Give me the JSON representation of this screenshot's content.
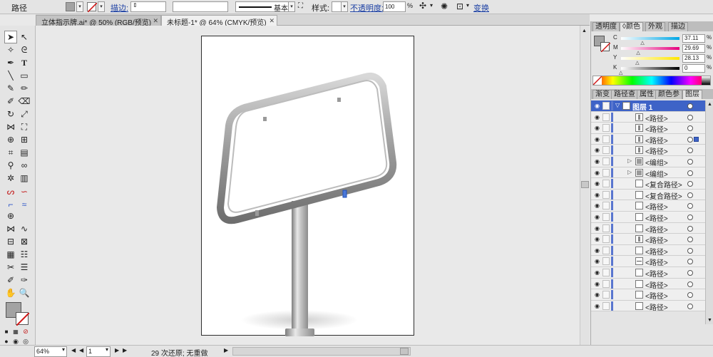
{
  "control_bar": {
    "selection_type": "路径",
    "stroke_label": "描边:",
    "brush_label": "基本",
    "style_label": "样式:",
    "opacity_label": "不透明度:",
    "opacity_value": "100",
    "opacity_unit": "%",
    "transform_label": "变换"
  },
  "doc_tabs": [
    {
      "title": "立体指示牌.ai* @ 50% (RGB/预览)"
    },
    {
      "title": "未标题-1* @ 64% (CMYK/预览)"
    }
  ],
  "color_panel": {
    "tabs": [
      "透明度",
      "颜色",
      "外观",
      "描边"
    ],
    "active_tab": "颜色",
    "channels": [
      {
        "label": "C",
        "value": "37.11",
        "unit": "%",
        "fraction": 0.3711
      },
      {
        "label": "M",
        "value": "29.69",
        "unit": "%",
        "fraction": 0.2969
      },
      {
        "label": "Y",
        "value": "28.13",
        "unit": "%",
        "fraction": 0.2813
      },
      {
        "label": "K",
        "value": "0",
        "unit": "%",
        "fraction": 0
      }
    ],
    "fill_color": "#a3a3a3"
  },
  "layers_panel": {
    "tabs": [
      "渐变",
      "路径查",
      "属性",
      "颜色参",
      "图层"
    ],
    "active_tab": "图层",
    "layer_name": "图层 1",
    "items": [
      {
        "name": "<路径>",
        "thumb": "bar"
      },
      {
        "name": "<路径>",
        "thumb": "bar"
      },
      {
        "name": "<路径>",
        "thumb": "bar",
        "selected": true
      },
      {
        "name": "<路径>",
        "thumb": "bar"
      },
      {
        "name": "<编组>",
        "thumb": "group",
        "expandable": true
      },
      {
        "name": "<编组>",
        "thumb": "group",
        "expandable": true
      },
      {
        "name": "<复合路径>",
        "thumb": "blank"
      },
      {
        "name": "<复合路径>",
        "thumb": "blank"
      },
      {
        "name": "<路径>",
        "thumb": "blank"
      },
      {
        "name": "<路径>",
        "thumb": "blank"
      },
      {
        "name": "<路径>",
        "thumb": "blank"
      },
      {
        "name": "<路径>",
        "thumb": "bar"
      },
      {
        "name": "<路径>",
        "thumb": "blank"
      },
      {
        "name": "<路径>",
        "thumb": "line"
      },
      {
        "name": "<路径>",
        "thumb": "blank"
      },
      {
        "name": "<路径>",
        "thumb": "blank"
      },
      {
        "name": "<路径>",
        "thumb": "blank"
      },
      {
        "name": "<路径>",
        "thumb": "blank"
      }
    ]
  },
  "status_bar": {
    "zoom": "64%",
    "artboard_number": "1",
    "undo_status": "29 次还原; 无重做"
  }
}
